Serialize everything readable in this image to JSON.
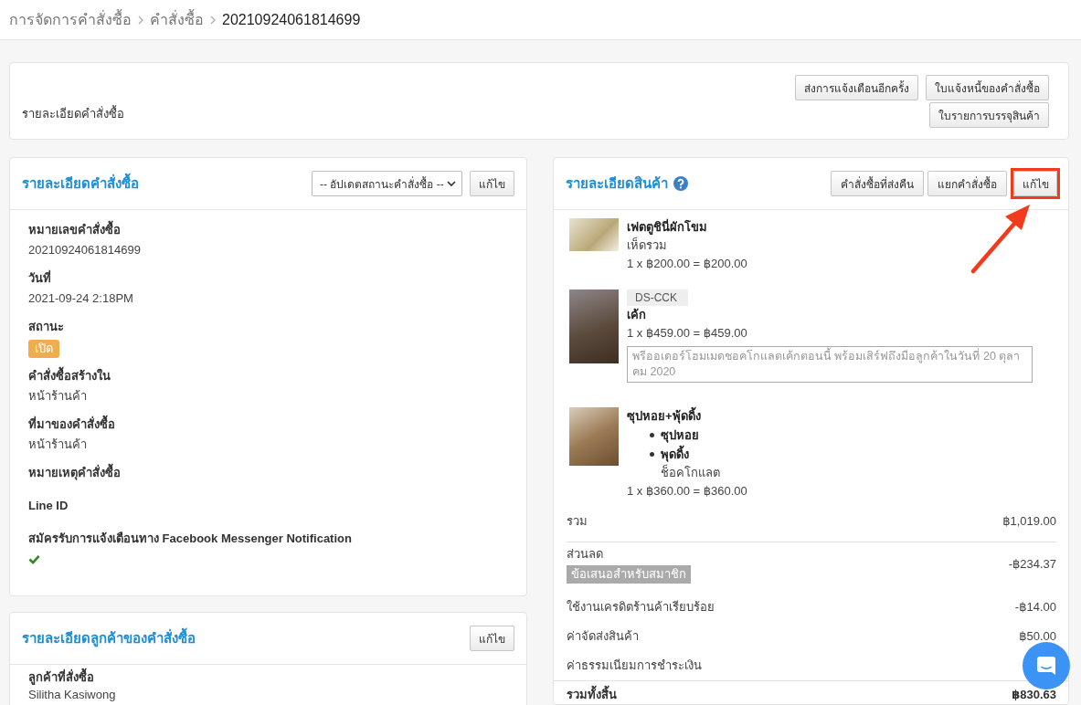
{
  "breadcrumb": [
    {
      "label": "การจัดการคำสั่งซื้อ",
      "current": false
    },
    {
      "label": "คำสั่งซื้อ",
      "current": false
    },
    {
      "label": "20210924061814699",
      "current": true
    }
  ],
  "header_card": {
    "label": "รายละเอียดคำสั่งซื้อ",
    "buttons": [
      "ส่งการแจ้งเตือนอีกครั้ง",
      "ใบแจ้งหนี้ของคำสั่งซื้อ",
      "ใบรายการบรรจุสินค้า"
    ]
  },
  "order_panel": {
    "title": "รายละเอียดคำสั่งซื้อ",
    "status_select": "-- อัปเดตสถานะคำสั่งซื้อ --",
    "edit_button": "แก้ไข",
    "fields": [
      {
        "kind": "text",
        "label": "หมายเลขคำสั่งซื้อ",
        "value": "20210924061814699"
      },
      {
        "kind": "text",
        "label": "วันที่",
        "value": "2021-09-24 2:18PM"
      },
      {
        "kind": "badge",
        "label": "สถานะ",
        "value": "เปิด"
      },
      {
        "kind": "text",
        "label": "คำสั่งซื้อสร้างใน",
        "value": "หน้าร้านค้า"
      },
      {
        "kind": "text",
        "label": "ที่มาของคำสั่งซื้อ",
        "value": "หน้าร้านค้า"
      },
      {
        "kind": "text",
        "label": "หมายเหตุคำสั่งซื้อ"
      },
      {
        "kind": "text",
        "label": "Line ID"
      },
      {
        "kind": "check",
        "label": "สมัครรับการแจ้งเตือนทาง Facebook Messenger Notification",
        "checked": true
      }
    ]
  },
  "customer_panel": {
    "title": "รายละเอียดลูกค้าของคำสั่งซื้อ",
    "edit_button": "แก้ไข",
    "fields": [
      {
        "label": "ลูกค้าที่สั่งซื้อ",
        "value": "Silitha Kasiwong"
      }
    ]
  },
  "products_panel": {
    "title": "รายละเอียดสินค้า",
    "buttons": [
      {
        "label": "คำสั่งซื้อที่ส่งคืน",
        "highlighted": false
      },
      {
        "label": "แยกคำสั่งซื้อ",
        "highlighted": false
      },
      {
        "label": "แก้ไข",
        "highlighted": true
      }
    ],
    "items": [
      {
        "name": "เฟตตูชินี่ผักโขม",
        "variant": "เห็ดรวม",
        "price_line": "1 x ฿200.00 = ฿200.00"
      },
      {
        "sku": "DS-CCK",
        "name": "เค้ก",
        "price_line": "1 x ฿459.00 = ฿459.00",
        "note": "พรีออเดอร์โฮมเมดชอคโกแลตเค้กตอนนี้ พร้อมเสิร์ฟถึงมือลูกค้าในวันที่ 20 ตุลาคม 2020"
      },
      {
        "name": "ซุปหอย+พุ้ดดิ้ง",
        "options": [
          {
            "name": "ซุปหอย"
          },
          {
            "name": "พุดดิ้ง",
            "detail": "ช็อคโกแลต"
          }
        ],
        "price_line": "1 x ฿360.00 = ฿360.00"
      }
    ],
    "totals": [
      {
        "kind": "subtotal",
        "label": "รวม",
        "amount": "฿1,019.00"
      },
      {
        "kind": "discount",
        "label": "ส่วนลด",
        "tag": "ข้อเสนอสำหรับสมาชิก",
        "amount": "-฿234.37"
      },
      {
        "kind": "line",
        "label": "ใช้งานเครดิตร้านค้าเรียบร้อย",
        "amount": "-฿14.00"
      },
      {
        "kind": "line",
        "label": "ค่าจัดส่งสินค้า",
        "amount": "฿50.00"
      },
      {
        "kind": "line",
        "label": "ค่าธรรมเนียมการชำระเงิน"
      },
      {
        "kind": "grand",
        "label": "รวมทั้งสิ้น",
        "amount": "฿830.63"
      }
    ]
  }
}
